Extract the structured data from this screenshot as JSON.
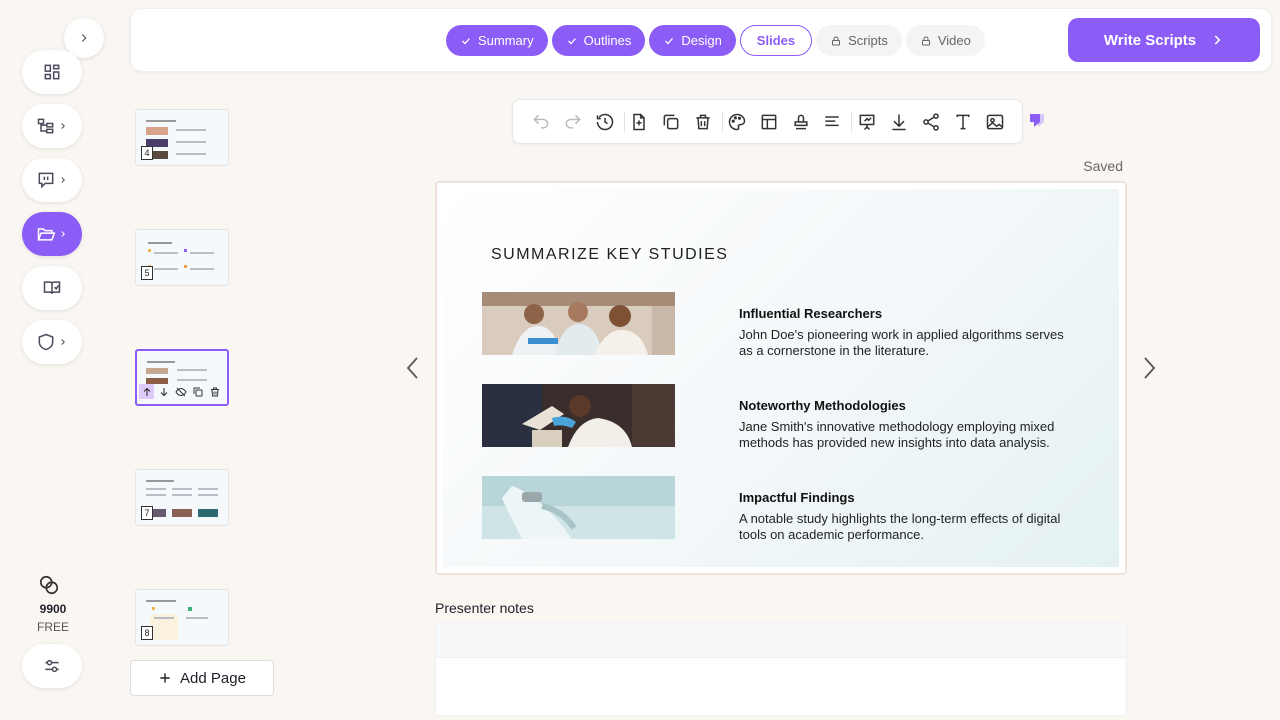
{
  "credits": {
    "amount": "9900",
    "plan": "FREE"
  },
  "steps": [
    {
      "label": "Summary",
      "state": "done"
    },
    {
      "label": "Outlines",
      "state": "done"
    },
    {
      "label": "Design",
      "state": "done"
    },
    {
      "label": "Slides",
      "state": "current"
    },
    {
      "label": "Scripts",
      "state": "locked"
    },
    {
      "label": "Video",
      "state": "locked"
    }
  ],
  "header": {
    "write_scripts_label": "Write Scripts"
  },
  "thumbnails": [
    {
      "num": "4"
    },
    {
      "num": "5"
    },
    {
      "num": "6",
      "selected": true
    },
    {
      "num": "7"
    },
    {
      "num": "8"
    }
  ],
  "add_page_label": "Add Page",
  "status": {
    "saved": "Saved"
  },
  "slide": {
    "title": "SUMMARIZE KEY STUDIES",
    "items": [
      {
        "heading": "Influential Researchers",
        "body": "John Doe's pioneering work in applied algorithms serves as a cornerstone in the literature."
      },
      {
        "heading": "Noteworthy Methodologies",
        "body": "Jane Smith's innovative methodology employing mixed methods has provided new insights into data analysis."
      },
      {
        "heading": "Impactful Findings",
        "body": "A notable study highlights the long-term effects of digital tools on academic performance."
      }
    ]
  },
  "notes": {
    "label": "Presenter notes"
  },
  "colors": {
    "accent": "#8b5cf6",
    "background": "#faf7f3"
  },
  "icons": [
    "panel-expand-icon",
    "layout-grid-icon",
    "tree-icon",
    "chat-icon",
    "folder-open-icon",
    "book-check-icon",
    "shield-icon",
    "coins-icon",
    "sliders-icon",
    "undo-icon",
    "redo-icon",
    "history-icon",
    "file-plus-icon",
    "copy-icon",
    "trash-icon",
    "palette-icon",
    "layout-icon",
    "stamp-icon",
    "align-icon",
    "presentation-icon",
    "download-icon",
    "share-icon",
    "text-icon",
    "image-icon"
  ]
}
